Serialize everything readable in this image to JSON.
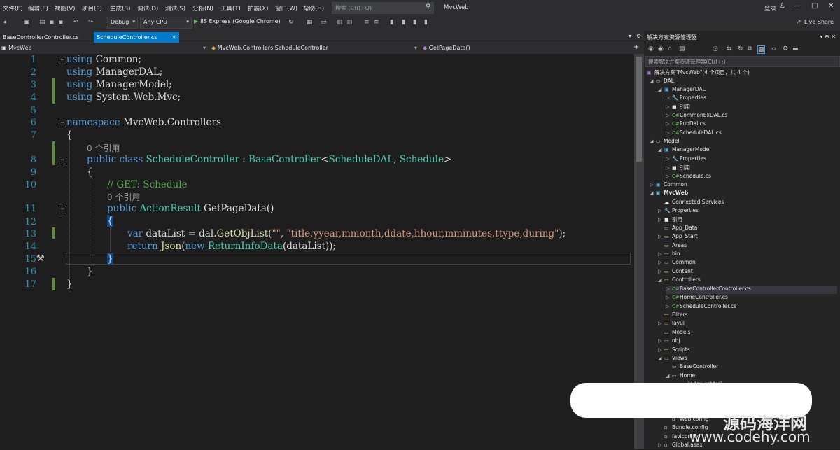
{
  "menu": [
    "文件(F)",
    "编辑(E)",
    "视图(V)",
    "项目(P)",
    "生成(B)",
    "调试(D)",
    "测试(S)",
    "分析(N)",
    "工具(T)",
    "扩展(X)",
    "窗口(W)",
    "帮助(H)"
  ],
  "search": {
    "placeholder": "搜索 (Ctrl+Q)"
  },
  "app_title": "MvcWeb",
  "login": "登录",
  "toolbar": {
    "config": "Debug",
    "platform": "Any CPU",
    "run": "IIS Express (Google Chrome)",
    "live_share": "Live Share"
  },
  "tabs": {
    "inactive": "BaseControllerController.cs",
    "active": "ScheduleController.cs"
  },
  "navbar": {
    "project": "MvcWeb",
    "class": "MvcWeb.Controllers.ScheduleController",
    "method": "GetPageData()"
  },
  "code": {
    "line_numbers": [
      "1",
      "2",
      "3",
      "4",
      "5",
      "6",
      "7",
      "8",
      "9",
      "10",
      "11",
      "12",
      "13",
      "14",
      "15",
      "16",
      "17"
    ],
    "l1_kw": "using",
    "l1_rest": " Common;",
    "l2_kw": "using",
    "l2_rest": " ManagerDAL;",
    "l3_kw": "using",
    "l3_rest": " ManagerModel;",
    "l4_kw": "using",
    "l4_rest": " System.Web.Mvc;",
    "l6_kw": "namespace",
    "l6_rest": " MvcWeb.Controllers",
    "l7": "{",
    "lens8": "0 个引用",
    "l8_kw1": "public",
    "l8_kw2": " class",
    "l8_name": " ScheduleController",
    "l8_colon": " : ",
    "l8_base": "BaseController",
    "l8_lt": "<",
    "l8_t1": "ScheduleDAL",
    "l8_comma": ", ",
    "l8_t2": "Schedule",
    "l8_gt": ">",
    "l9": "{",
    "l10_comment": "// GET: Schedule",
    "lens11": "0 个引用",
    "l11_kw": "public",
    "l11_type": " ActionResult",
    "l11_rest": " GetPageData()",
    "l12": "{",
    "l13_kw": "var",
    "l13_a": " dataList = dal.",
    "l13_m": "GetObjList",
    "l13_b": "(",
    "l13_s1": "\"\"",
    "l13_c": ", ",
    "l13_s2": "\"title,yyear,mmonth,ddate,hhour,mminutes,ttype,during\"",
    "l13_d": ");",
    "l14_kw": "return",
    "l14_m": " Json",
    "l14_a": "(",
    "l14_new": "new",
    "l14_type": " ReturnInfoData",
    "l14_b": "(dataList));",
    "l15": "}",
    "l16": "}",
    "l17": "}"
  },
  "solution_explorer": {
    "title": "解决方案资源管理器",
    "search_placeholder": "搜索解决方案资源管理器(Ctrl+;)",
    "items": [
      {
        "label": "解决方案\"MvcWeb\"(4 个项目，共 4 个)",
        "icon": "solution-icon"
      },
      {
        "label": "DAL",
        "icon": "project-icon"
      },
      {
        "label": "ManagerDAL",
        "icon": "project-icon"
      },
      {
        "label": "Properties",
        "icon": "wrench-icon"
      },
      {
        "label": "引用",
        "icon": "references-icon"
      },
      {
        "label": "CommonExDAL.cs",
        "icon": "csharp-file-icon"
      },
      {
        "label": "PubDal.cs",
        "icon": "csharp-file-icon"
      },
      {
        "label": "ScheduleDAL.cs",
        "icon": "csharp-file-icon"
      },
      {
        "label": "Model",
        "icon": "project-icon"
      },
      {
        "label": "ManagerModel",
        "icon": "project-icon"
      },
      {
        "label": "Properties",
        "icon": "wrench-icon"
      },
      {
        "label": "引用",
        "icon": "references-icon"
      },
      {
        "label": "Schedule.cs",
        "icon": "csharp-file-icon"
      },
      {
        "label": "Common",
        "icon": "project-icon"
      },
      {
        "label": "MvcWeb",
        "icon": "web-project-icon"
      },
      {
        "label": "Connected Services",
        "icon": "services-icon"
      },
      {
        "label": "Properties",
        "icon": "wrench-icon"
      },
      {
        "label": "引用",
        "icon": "references-icon"
      },
      {
        "label": "App_Data",
        "icon": "folder-icon"
      },
      {
        "label": "App_Start",
        "icon": "folder-icon"
      },
      {
        "label": "Areas",
        "icon": "folder-icon"
      },
      {
        "label": "bin",
        "icon": "folder-icon"
      },
      {
        "label": "Common",
        "icon": "folder-icon"
      },
      {
        "label": "Content",
        "icon": "folder-icon"
      },
      {
        "label": "Controllers",
        "icon": "folder-icon"
      },
      {
        "label": "BaseControllerController.cs",
        "icon": "csharp-file-icon"
      },
      {
        "label": "HomeController.cs",
        "icon": "csharp-file-icon"
      },
      {
        "label": "ScheduleController.cs",
        "icon": "csharp-file-icon"
      },
      {
        "label": "Filters",
        "icon": "folder-icon"
      },
      {
        "label": "layui",
        "icon": "folder-icon"
      },
      {
        "label": "Models",
        "icon": "folder-icon"
      },
      {
        "label": "obj",
        "icon": "folder-icon"
      },
      {
        "label": "Scripts",
        "icon": "folder-icon"
      },
      {
        "label": "Views",
        "icon": "folder-icon"
      },
      {
        "label": "BaseController",
        "icon": "folder-icon"
      },
      {
        "label": "Home",
        "icon": "folder-icon"
      },
      {
        "label": "Index.cshtml",
        "icon": "cshtml-file-icon"
      },
      {
        "label": "Web.config",
        "icon": "config-file-icon"
      },
      {
        "label": "Bundle.config",
        "icon": "config-file-icon"
      },
      {
        "label": "favicon.ico",
        "icon": "image-file-icon"
      },
      {
        "label": "Global.asax",
        "icon": "file-icon"
      }
    ]
  },
  "watermark": {
    "title": "源码海洋网",
    "url": "www.codehy.com"
  },
  "colors": {
    "accent": "#007acc",
    "keyword": "#569cd6",
    "type": "#4ec9b0",
    "comment": "#57a64a",
    "string": "#d69d85",
    "line_number": "#2b91af"
  }
}
